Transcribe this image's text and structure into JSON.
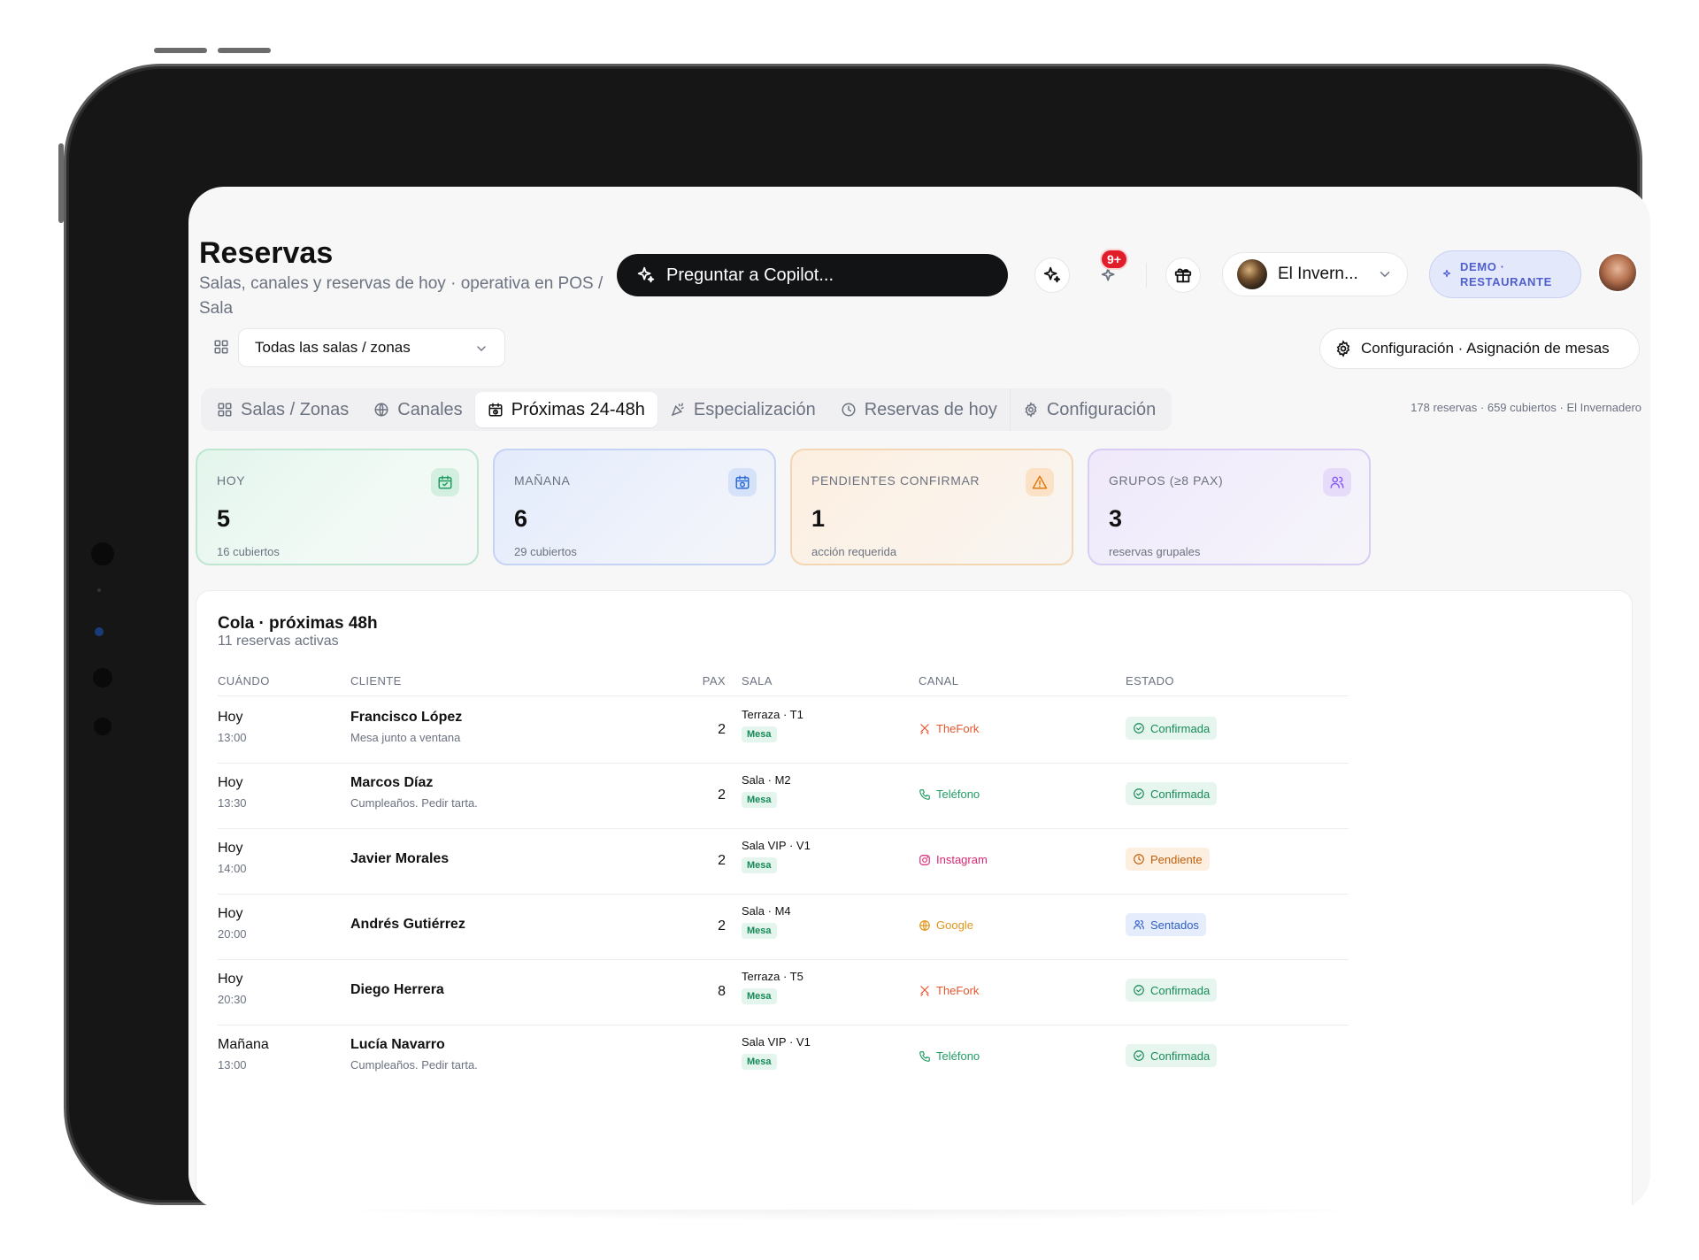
{
  "header": {
    "title": "Reservas",
    "subtitle": "Salas, canales y reservas de hoy · operativa en POS / Sala",
    "copilot_placeholder": "Preguntar a Copilot...",
    "notifications_badge": "9+",
    "restaurant_selector": "El Invern...",
    "demo_badge_line1": "DEMO ·",
    "demo_badge_line2": "RESTAURANTE"
  },
  "toolbar": {
    "zone_select_value": "Todas las salas / zonas",
    "config_button": "Configuración · Asignación de mesas"
  },
  "tabs": [
    {
      "label": "Salas / Zonas",
      "icon": "grid-icon",
      "active": false
    },
    {
      "label": "Canales",
      "icon": "globe-icon",
      "active": false
    },
    {
      "label": "Próximas 24-48h",
      "icon": "calendar-clock-icon",
      "active": true
    },
    {
      "label": "Especialización",
      "icon": "party-popper-icon",
      "active": false
    },
    {
      "label": "Reservas de hoy",
      "icon": "clock-icon",
      "active": false
    },
    {
      "label": "Configuración",
      "icon": "gear-icon",
      "active": false
    }
  ],
  "summary": "178 reservas · 659 cubiertos · El Invernadero",
  "kpis": [
    {
      "label": "HOY",
      "value": "5",
      "foot": "16 cubiertos",
      "icon": "calendar-check-icon",
      "color": "#1f9d63"
    },
    {
      "label": "MAÑANA",
      "value": "6",
      "foot": "29 cubiertos",
      "icon": "calendar-clock-icon",
      "color": "#2f6fd6"
    },
    {
      "label": "PENDIENTES CONFIRMAR",
      "value": "1",
      "foot": "acción requerida",
      "icon": "alert-triangle-icon",
      "color": "#e07a12"
    },
    {
      "label": "GRUPOS (≥8 PAX)",
      "value": "3",
      "foot": "reservas grupales",
      "icon": "users-icon",
      "color": "#8b5cf6"
    }
  ],
  "queue": {
    "title": "Cola · próximas 48h",
    "subtitle": "11 reservas activas",
    "columns": [
      "CUÁNDO",
      "CLIENTE",
      "PAX",
      "SALA",
      "CANAL",
      "ESTADO"
    ],
    "rows": [
      {
        "day": "Hoy",
        "time": "13:00",
        "client": "Francisco López",
        "note": "Mesa junto a ventana",
        "pax": "2",
        "sala": "Terraza · T1",
        "tag": "Mesa",
        "canal": "TheFork",
        "canal_icon": "fork-knife-icon",
        "canal_color": "#e4572e",
        "estado": "Confirmada",
        "estado_kind": "green"
      },
      {
        "day": "Hoy",
        "time": "13:30",
        "client": "Marcos Díaz",
        "note": "Cumpleaños. Pedir tarta.",
        "pax": "2",
        "sala": "Sala · M2",
        "tag": "Mesa",
        "canal": "Teléfono",
        "canal_icon": "phone-icon",
        "canal_color": "#1f9d63",
        "estado": "Confirmada",
        "estado_kind": "green"
      },
      {
        "day": "Hoy",
        "time": "14:00",
        "client": "Javier Morales",
        "note": "",
        "pax": "2",
        "sala": "Sala VIP · V1",
        "tag": "Mesa",
        "canal": "Instagram",
        "canal_icon": "instagram-icon",
        "canal_color": "#d62976",
        "estado": "Pendiente",
        "estado_kind": "orange"
      },
      {
        "day": "Hoy",
        "time": "20:00",
        "client": "Andrés Gutiérrez",
        "note": "",
        "pax": "2",
        "sala": "Sala · M4",
        "tag": "Mesa",
        "canal": "Google",
        "canal_icon": "globe-icon",
        "canal_color": "#e0961a",
        "estado": "Sentados",
        "estado_kind": "blue"
      },
      {
        "day": "Hoy",
        "time": "20:30",
        "client": "Diego Herrera",
        "note": "",
        "pax": "8",
        "sala": "Terraza · T5",
        "tag": "Mesa",
        "canal": "TheFork",
        "canal_icon": "fork-knife-icon",
        "canal_color": "#e4572e",
        "estado": "Confirmada",
        "estado_kind": "green"
      },
      {
        "day": "Mañana",
        "time": "13:00",
        "client": "Lucía Navarro",
        "note": "Cumpleaños. Pedir tarta.",
        "pax": "",
        "sala": "Sala VIP · V1",
        "tag": "Mesa",
        "canal": "Teléfono",
        "canal_icon": "phone-icon",
        "canal_color": "#1f9d63",
        "estado": "Confirmada",
        "estado_kind": "green"
      }
    ]
  }
}
